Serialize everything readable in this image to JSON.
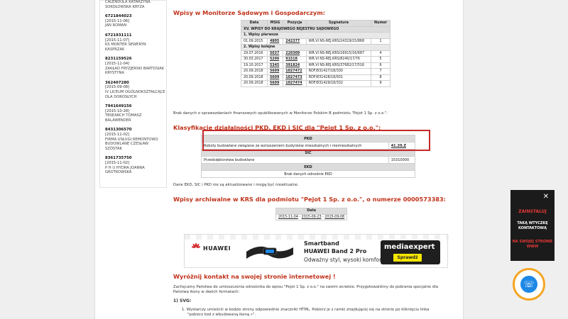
{
  "sidebar": {
    "items": [
      {
        "num": "",
        "date": "",
        "name": "CALENDULA KATARZYNA SOKOŁOWSKA KRYZA"
      },
      {
        "num": "6721844023",
        "date": "[2015-11-06]",
        "name": "JAN ROMAN"
      },
      {
        "num": "6721931111",
        "date": "[2015-11-07]",
        "name": "KS MONTER SEWERYN KASPRZAK"
      },
      {
        "num": "8231159526",
        "date": "[2015-11-04]",
        "name": "ZAKŁAD FRYZJERSKI BARTOSIAK KRYSTYNA"
      },
      {
        "num": "362407280",
        "date": "[2015-09-08]",
        "name": "IV LICEUM OGÓLNOKSZTAŁCĄCE DLA DOROSŁYCH"
      },
      {
        "num": "7941649156",
        "date": "[2015-10-28]",
        "name": "TBSEARCH TOMASZ BALAWENDER"
      },
      {
        "num": "8431306570",
        "date": "[2015-11-02]",
        "name": "FIRMA USŁUGI REMONTOWO BUDOWLANE CZESŁAW SZÓSTAK"
      },
      {
        "num": "8361735750",
        "date": "[2015-11-02]",
        "name": "P H U HYDRA JOANNA GROTKOWSKA"
      }
    ]
  },
  "monitor": {
    "heading": "Wpisy w Monitorze Sądowym i Gospodarczym:",
    "headers": [
      "Data",
      "MSiG",
      "Pozycja",
      "Sygnatura",
      "Numer"
    ],
    "section": "XV. WPISY DO KRAJOWEGO REJESTRU SĄDOWEGO",
    "sub1": "1. Wpisy pierwsze",
    "sub2": "2. Wpisy kolejne",
    "rows_first": [
      [
        "01.09.2015",
        "4805",
        "242377",
        "WR.VI NS-REJ.KRS/24329/15/868",
        "1"
      ]
    ],
    "rows_next": [
      [
        "29.07.2016",
        "5037",
        "229309",
        "WR.VI NS-REJ.KRS/16915/16/687",
        "4"
      ],
      [
        "30.03.2017",
        "5206",
        "91518",
        "WR.VI NS-REJ.KRS/8240/17/76",
        "5"
      ],
      [
        "19.10.2017",
        "5345",
        "391824",
        "WR.VI NS-REJ.KRS/37682/17/516",
        "6"
      ],
      [
        "20.09.2018",
        "5609",
        "1027472",
        "RDF/831427/18/330",
        "7"
      ],
      [
        "20.09.2018",
        "5609",
        "1027473",
        "RDF/831428/18/931",
        "8"
      ],
      [
        "20.09.2018",
        "5609",
        "1027474",
        "RDF/831429/18/332",
        "9"
      ]
    ],
    "note": "Brak danych o sprawozdaniach finansowych opublikowanych w Monitorze Polskim B podmiotu \"Pejot 1 Sp. z o.o.\"."
  },
  "pkd": {
    "heading": "Klasyfikacje działalności PKD, EKD i SIC dla \"Pejot 1 Sp. z o.o.\":",
    "pkd_label": "PKD",
    "pkd_desc": "Roboty budowlane związane ze wznoszeniem budynków mieszkalnych i niemieszkalnych",
    "pkd_code": "41.20.Z",
    "sic_label": "SIC",
    "sic_desc": "Przedsiębiorstwa budowlane",
    "sic_code": "15310000",
    "ekd_label": "EKD",
    "ekd_desc": "Brak danych odnośnie EKD",
    "note": "Dane EKD, SIC i PKD nie są aktualizowane i mogą być nieaktualne."
  },
  "archive": {
    "heading": "Wpisy archiwalne w KRS dla podmiotu \"Pejot 1 Sp. z o.o.\", o numerze 0000573383:",
    "date_label": "Data",
    "dates": [
      "2015-11-04",
      "2015-09-23",
      "2015-09-08"
    ]
  },
  "ad": {
    "brand": "HUAWEI",
    "title1": "Smartband",
    "title2": "HUAWEI Band 2 Pro",
    "subtitle": "Odważny styl, wysoki komfort",
    "store": "mediaexpert",
    "cta": "Sprawdź"
  },
  "promo": {
    "heading": "Wyróżnij kontakt na swojej stronie internetowej !",
    "p1": "Zachęcamy Państwa do umieszczenia odnośnika do wpisu \"Pejot 1 Sp. z o.o.\" na swoim serwisie. Przygotowaliśmy do pobrania specjalne dla",
    "p2": "Państwa ikony w dwóch formatach:",
    "svg": "1) SVG:",
    "li1": "1. Wystarczy umieścić w kodzie strony odpowiednie znaczniki HTML. Pobierz je z ramki znajdującej się na stronie po kliknięciu linka",
    "li2": "\"pobierz kod z wbudowaną ikoną »\"."
  },
  "widget": {
    "close": "✕",
    "line1": "ZAINSTALUJ",
    "line2": "TAKĄ WTYCZKĘ KONTAKTOWĄ",
    "line3": "NA SWOJEJ STRONIE WWW"
  }
}
